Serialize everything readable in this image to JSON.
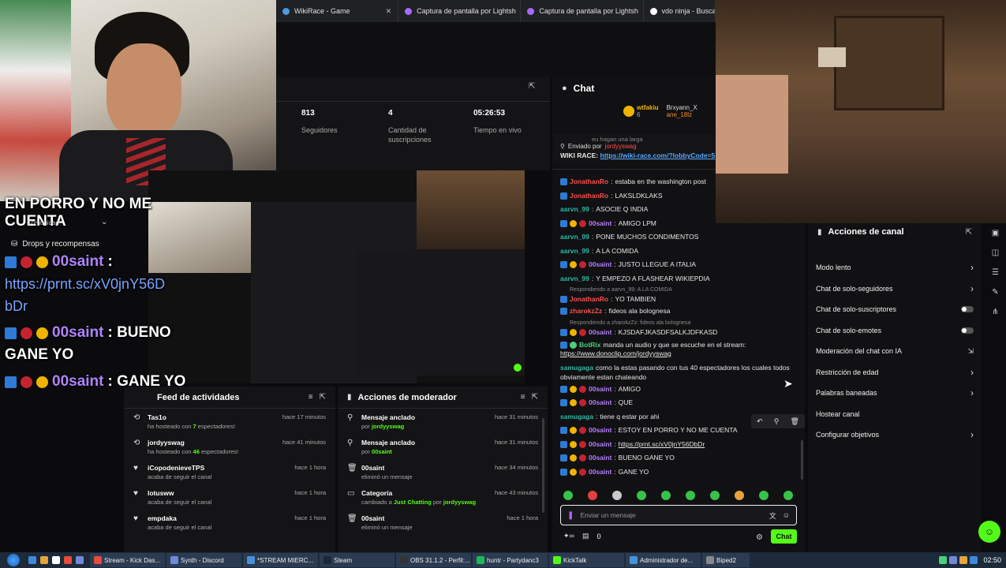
{
  "chrome_tabs": [
    {
      "label": "WikiRace - Game",
      "color": "#4a9ae0"
    },
    {
      "label": "Captura de pantalla por Lightsh",
      "color": "#a56bff"
    },
    {
      "label": "Captura de pantalla por Lightsh",
      "color": "#a56bff"
    },
    {
      "label": "vdo ninja - Buscar c",
      "color": "#ffffff"
    }
  ],
  "stats": [
    {
      "value": "813",
      "label": "Seguidores"
    },
    {
      "value": "4",
      "label": "Cantidad de suscripciones"
    },
    {
      "value": "05:26:53",
      "label": "Tiempo en vivo"
    }
  ],
  "overlay": {
    "headline_1": "EN PORRO Y NO ME",
    "headline_2": "CUENTA",
    "community": "Comunidad",
    "drops": "Drops y recompensas",
    "msg1_user": "00saint",
    "msg1_sep": ":",
    "msg1_link": "https://prnt.sc/xV0jnY56D",
    "msg1_link2": "bDr",
    "msg2_user": "00saint",
    "msg2_text": ": BUENO",
    "msg2_text2": "GANE YO",
    "msg3_user": "00saint",
    "msg3_text": ": GANE YO"
  },
  "chat": {
    "title": "Chat",
    "top_users": [
      {
        "name": "wtfakiu",
        "count": "6"
      },
      {
        "name": "Brxyann_X"
      },
      {
        "name": "ane_18lz"
      }
    ],
    "pinned_prev": "eu hagan una larga",
    "pinned_by": "Enviado por",
    "pinned_user": "jordyyswag",
    "pinned_msg": "WIKI RACE:",
    "pinned_link": "https://wiki-race.com/?lobbyCode=5",
    "messages": [
      {
        "user": "JonathanRo",
        "text": "estaba en the washington post",
        "ucls": "r",
        "badges": [
          "b"
        ]
      },
      {
        "user": "JonathanRo",
        "text": "LAKSLDKLAKS",
        "ucls": "r",
        "badges": []
      },
      {
        "user": "aarvn_99",
        "text": "ASOCIE Q INDIA",
        "ucls": "t",
        "badges": []
      },
      {
        "user": "00saint",
        "text": "AMIGO LPM",
        "ucls": "p",
        "badges": [
          "b",
          "g",
          "r"
        ]
      },
      {
        "user": "aarvn_99",
        "text": "PONE MUCHOS CONDIMENTOS",
        "ucls": "t",
        "badges": []
      },
      {
        "user": "aarvn_99",
        "text": "A LA COMIDA",
        "ucls": "t",
        "badges": []
      },
      {
        "user": "00saint",
        "text": "JUSTO LLEGUE A ITALIA",
        "ucls": "p",
        "badges": [
          "b",
          "g",
          "r"
        ]
      },
      {
        "user": "aarvn_99",
        "text": "Y EMPEZO A FLASHEAR WIKIEPDIA",
        "ucls": "t",
        "badges": []
      },
      {
        "user": "JonathanRo",
        "text": "YO TAMBIEN",
        "ucls": "r",
        "badges": [],
        "reply": "Respondiendo a aarvn_99: A LA COMIDA"
      },
      {
        "user": "zharokzZz",
        "text": "fideos ala bolognesa",
        "ucls": "r",
        "badges": []
      },
      {
        "user": "00saint",
        "text": "KJSDAFJKASDFSALKJDFKASD",
        "ucls": "p",
        "badges": [
          "b",
          "g",
          "r"
        ],
        "reply": "Respondiendo a zharokzZz: fideos ala bolognesa"
      }
    ],
    "botrix_user": "BotRix",
    "botrix_text": "manda un audio y que se escuche en el stream:",
    "botrix_link": "https://www.donoclip.com/jordyyswag",
    "samu_user": "samugaga",
    "samu_text": "como la estas pasando con tus 40 espectadores los cuales todos",
    "samu_text2": "obviamente estan chateando",
    "tail": [
      {
        "user": "00saint",
        "text": "AMIGO",
        "ucls": "p"
      },
      {
        "user": "00saint",
        "text": "QUE",
        "ucls": "p"
      },
      {
        "user": "samugaga",
        "text": "tiene q estar por ahi",
        "ucls": "t",
        "nobadge": true
      },
      {
        "user": "00saint",
        "text": "ESTOY EN PORRO Y NO ME CUENTA",
        "ucls": "p"
      },
      {
        "user": "00saint",
        "text": "https://prnt.sc/xV0jnY56DbDr",
        "ucls": "p",
        "link": true
      },
      {
        "user": "00saint",
        "text": "BUENO GANE YO",
        "ucls": "p"
      },
      {
        "user": "00saint",
        "text": "GANE YO",
        "ucls": "p"
      }
    ],
    "input_placeholder": "Enviar un mensaje",
    "points": "0",
    "send_label": "Chat"
  },
  "channel_actions": {
    "title": "Acciones de canal",
    "items": [
      {
        "label": "Modo lento",
        "type": "arrow"
      },
      {
        "label": "Chat de solo-seguidores",
        "type": "arrow"
      },
      {
        "label": "Chat de solo-suscriptores",
        "type": "toggle"
      },
      {
        "label": "Chat de solo-emotes",
        "type": "toggle"
      },
      {
        "label": "Moderación del chat con IA",
        "type": "icon"
      },
      {
        "label": "Restricción de edad",
        "type": "arrow"
      },
      {
        "label": "Palabras baneadas",
        "type": "arrow"
      },
      {
        "label": "Hostear canal",
        "type": "none"
      },
      {
        "label": "Configurar objetivos",
        "type": "arrow"
      }
    ]
  },
  "activity": {
    "title": "Feed de actividades",
    "rows": [
      {
        "name": "Tas1o",
        "desc_pre": "ha hosteado con ",
        "desc_hl": "7",
        "desc_post": " espectadores!",
        "time": "hace 17 minutos",
        "icon": "host"
      },
      {
        "name": "jordyyswag",
        "desc_pre": "ha hosteado con ",
        "desc_hl": "46",
        "desc_post": " espectadores!",
        "time": "hace 41 minutos",
        "icon": "host"
      },
      {
        "name": "iCopodenieveTPS",
        "desc_pre": "acaba de seguir el canal",
        "desc_hl": "",
        "desc_post": "",
        "time": "hace 1 hora",
        "icon": "heart"
      },
      {
        "name": "lotusww",
        "desc_pre": "acaba de seguir el canal",
        "desc_hl": "",
        "desc_post": "",
        "time": "hace 1 hora",
        "icon": "heart"
      },
      {
        "name": "empdaka",
        "desc_pre": "acaba de seguir el canal",
        "desc_hl": "",
        "desc_post": "",
        "time": "hace 1 hora",
        "icon": "heart"
      }
    ]
  },
  "mod_actions": {
    "title": "Acciones de moderador",
    "rows": [
      {
        "name": "Mensaje anclado",
        "desc_pre": "por ",
        "desc_hl": "jordyyswag",
        "desc_post": "",
        "desc_hl2": "",
        "time": "hace 31 minutos",
        "icon": "pin"
      },
      {
        "name": "Mensaje anclado",
        "desc_pre": "por ",
        "desc_hl": "00saint",
        "desc_post": "",
        "desc_hl2": "",
        "time": "hace 31 minutos",
        "icon": "pin"
      },
      {
        "name": "00saint",
        "desc_pre": "eliminó un mensaje",
        "desc_hl": "",
        "desc_post": "",
        "desc_hl2": "",
        "time": "hace 34 minutos",
        "icon": "trash"
      },
      {
        "name": "Categoría",
        "desc_pre": "cambiado a ",
        "desc_hl": "Just Chatting",
        "desc_post": " por ",
        "desc_hl2": "jordyyswag",
        "time": "hace 43 minutos",
        "icon": "cat"
      },
      {
        "name": "00saint",
        "desc_pre": "eliminó un mensaje",
        "desc_hl": "",
        "desc_post": "",
        "desc_hl2": "",
        "time": "hace 1 hora",
        "icon": "trash"
      }
    ]
  },
  "taskbar": {
    "items": [
      {
        "label": "Stream - Kick Das...",
        "color": "#e74c3c"
      },
      {
        "label": "Synth - Discord",
        "color": "#7289da"
      },
      {
        "label": "*STREAM MIERC...",
        "color": "#4a90d9"
      },
      {
        "label": "Steam",
        "color": "#1b2838"
      },
      {
        "label": "OBS 31.1.2 - Perfil:...",
        "color": "#333"
      },
      {
        "label": "huntr - Partydanc3",
        "color": "#1db954"
      },
      {
        "label": "KickTalk",
        "color": "#53fc18"
      },
      {
        "label": "Administrador de...",
        "color": "#4a90d9"
      },
      {
        "label": "Biped2",
        "color": "#888"
      }
    ],
    "clock": "02:50"
  }
}
